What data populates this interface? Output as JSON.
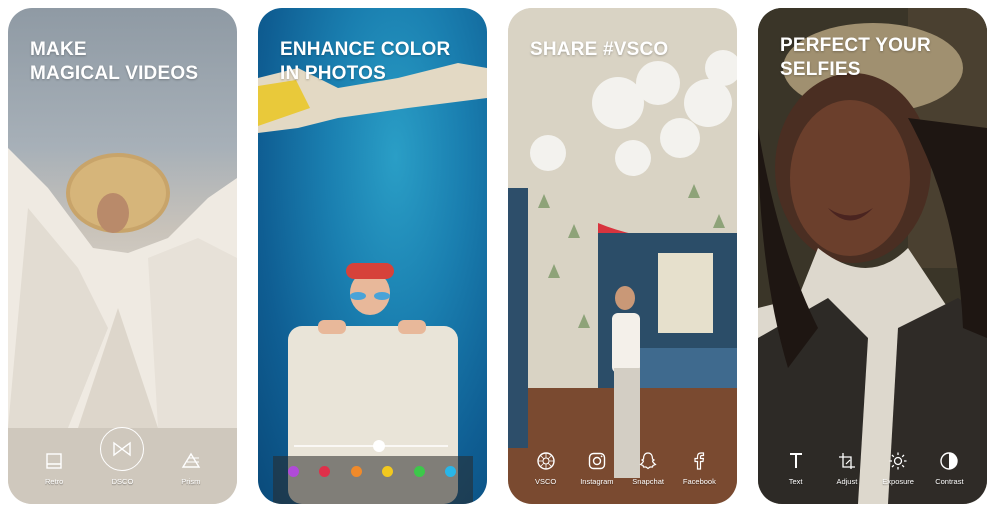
{
  "panels": [
    {
      "headline": [
        "MAKE",
        "MAGICAL VIDEOS"
      ],
      "tools": [
        {
          "label": "Retro",
          "icon": "retro-icon"
        },
        {
          "label": "DSCO",
          "icon": "dsco-icon"
        },
        {
          "label": "Prism",
          "icon": "prism-icon"
        }
      ]
    },
    {
      "headline": [
        "ENHANCE COLOR",
        "IN PHOTOS"
      ],
      "slider": {
        "value": 0.55
      },
      "swatches": [
        "#b04ad8",
        "#e0304a",
        "#f08a2a",
        "#f2c81e",
        "#3cc84a",
        "#29b6e8"
      ]
    },
    {
      "headline": [
        "SHARE #VSCO"
      ],
      "tools": [
        {
          "label": "VSCO",
          "icon": "vsco-icon"
        },
        {
          "label": "Instagram",
          "icon": "instagram-icon"
        },
        {
          "label": "Snapchat",
          "icon": "snapchat-icon"
        },
        {
          "label": "Facebook",
          "icon": "facebook-icon"
        }
      ]
    },
    {
      "headline": [
        "PERFECT YOUR",
        "SELFIES"
      ],
      "tools": [
        {
          "label": "Text",
          "icon": "text-icon"
        },
        {
          "label": "Adjust",
          "icon": "adjust-icon"
        },
        {
          "label": "Exposure",
          "icon": "exposure-icon"
        },
        {
          "label": "Contrast",
          "icon": "contrast-icon"
        }
      ]
    }
  ]
}
